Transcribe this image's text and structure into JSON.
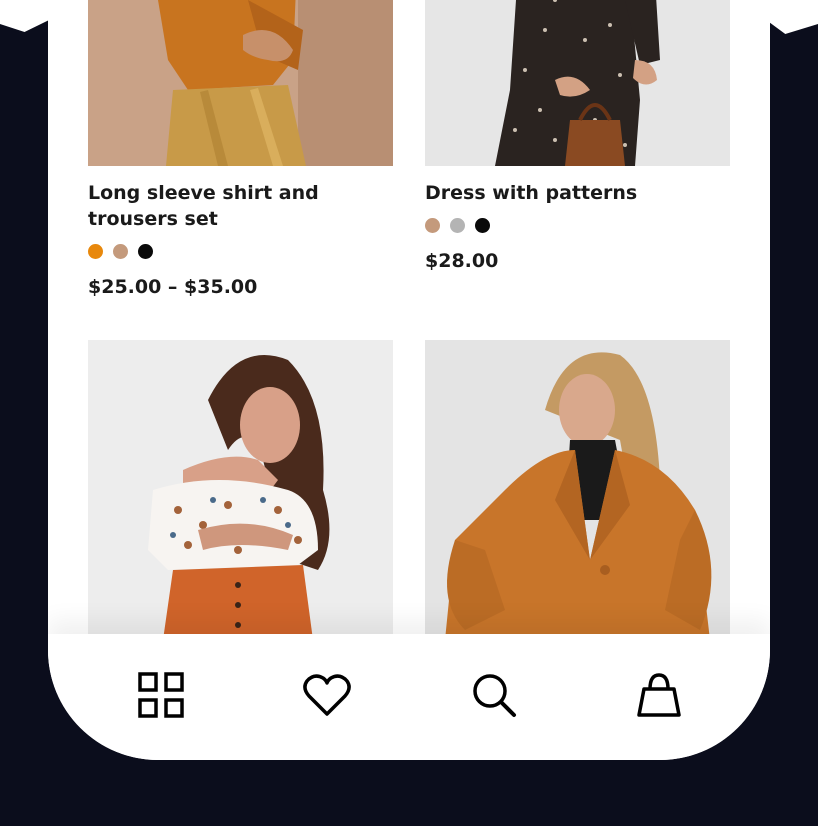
{
  "products": [
    {
      "title": "Long sleeve shirt and trousers set",
      "swatches": [
        "#e8880c",
        "#c49a7c",
        "#0a0a0a"
      ],
      "price": "$25.00 – $35.00"
    },
    {
      "title": "Dress with patterns",
      "swatches": [
        "#c49a7c",
        "#b4b4b4",
        "#0a0a0a"
      ],
      "price": "$28.00"
    },
    {
      "title": "",
      "swatches": [],
      "price": ""
    },
    {
      "title": "",
      "swatches": [],
      "price": ""
    }
  ],
  "nav": {
    "items": [
      {
        "icon": "grid-icon"
      },
      {
        "icon": "heart-icon"
      },
      {
        "icon": "search-icon"
      },
      {
        "icon": "shopping-bag-icon"
      }
    ]
  },
  "colors": {
    "background": "#0b0d1c",
    "text": "#1a1a1a"
  }
}
